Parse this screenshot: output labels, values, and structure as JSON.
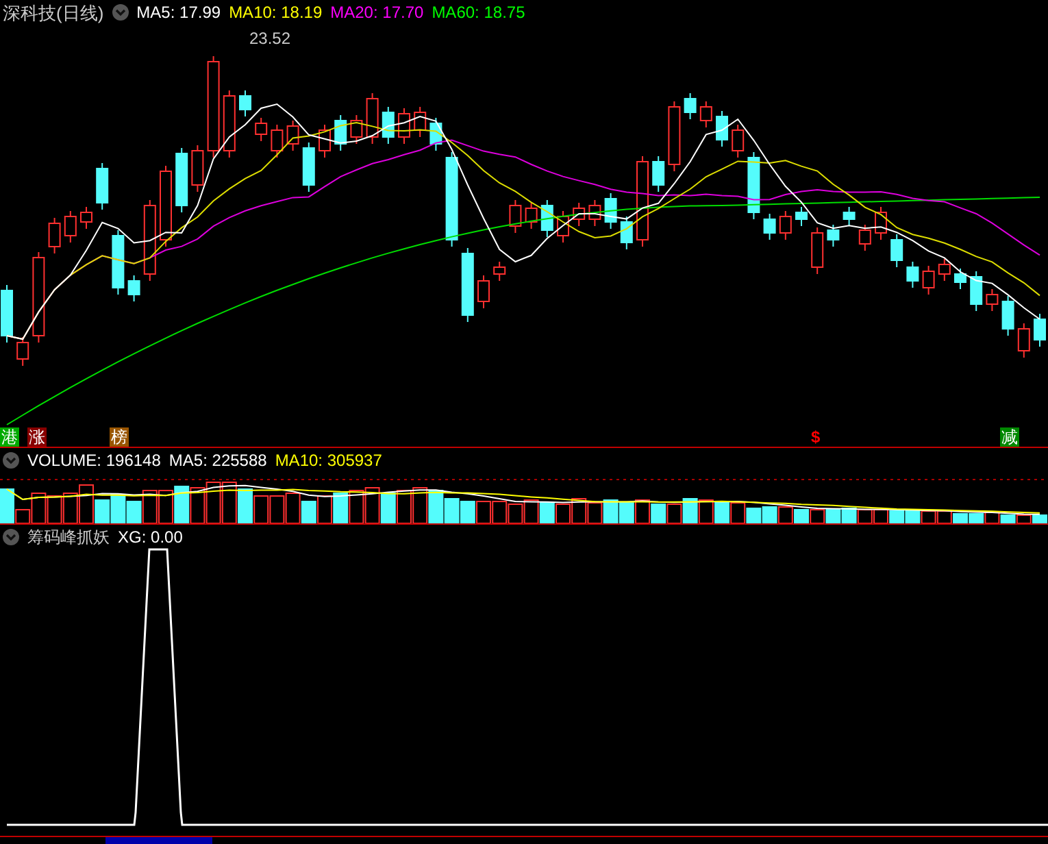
{
  "main_header": {
    "title": "深科技(日线)",
    "indicators": [
      {
        "label": "MA5:",
        "value": "17.99",
        "color": "#ffffff"
      },
      {
        "label": "MA10:",
        "value": "18.19",
        "color": "#ffff00"
      },
      {
        "label": "MA20:",
        "value": "17.70",
        "color": "#ff00ff"
      },
      {
        "label": "MA60:",
        "value": "18.75",
        "color": "#00ff00"
      }
    ]
  },
  "high_label": "23.52",
  "signal_tags": [
    {
      "text": "港",
      "color": "#00aa00",
      "kind": "box"
    },
    {
      "text": "涨",
      "color": "#880000",
      "kind": "box"
    },
    {
      "text": "榜",
      "color": "#995500",
      "kind": "box"
    },
    {
      "text": "$",
      "color": "#ff0000",
      "kind": "plain"
    },
    {
      "text": "减",
      "color": "#008800",
      "kind": "box"
    }
  ],
  "volume_header": {
    "indicators": [
      {
        "label": "VOLUME:",
        "value": "196148",
        "color": "#ffffff"
      },
      {
        "label": "MA5:",
        "value": "225588",
        "color": "#ffffff"
      },
      {
        "label": "MA10:",
        "value": "305937",
        "color": "#ffff00"
      }
    ]
  },
  "indicator_header": {
    "title": "筹码峰抓妖",
    "indicators": [
      {
        "label": "XG:",
        "value": "0.00",
        "color": "#ffffff"
      }
    ]
  }
}
